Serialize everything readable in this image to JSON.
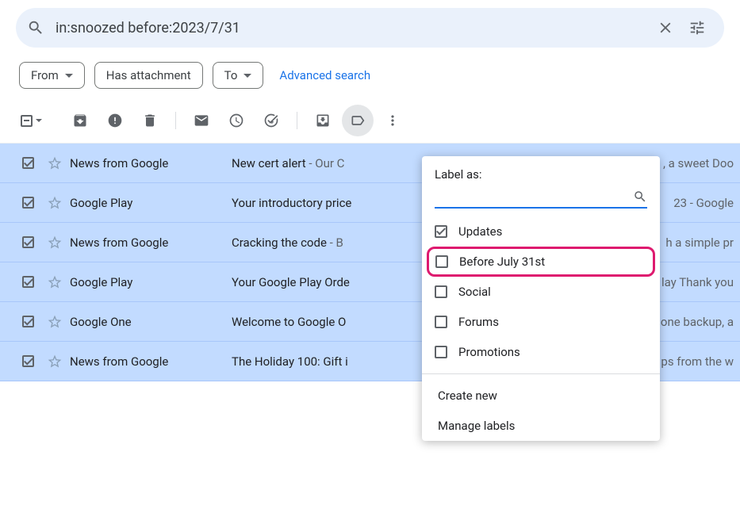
{
  "search": {
    "query": "in:snoozed before:2023/7/31"
  },
  "chips": {
    "from": "From",
    "has_attachment": "Has attachment",
    "to": "To",
    "advanced": "Advanced search"
  },
  "toolbar": {
    "more_tooltip": "More"
  },
  "emails": [
    {
      "sender": "News from Google",
      "subject": "New cert alert",
      "snippet": " - Our C",
      "tail": ", a sweet Doo"
    },
    {
      "sender": "Google Play",
      "subject": "Your introductory price",
      "snippet": "",
      "tail": "23 - Google "
    },
    {
      "sender": "News from Google",
      "subject": "Cracking the code",
      "snippet": " - B",
      "tail": "h a simple pr"
    },
    {
      "sender": "Google Play",
      "subject": "Your Google Play Orde",
      "snippet": "",
      "tail": "lay Thank you"
    },
    {
      "sender": "Google One",
      "subject": "Welcome to Google O",
      "snippet": "",
      "tail": "one backup, a"
    },
    {
      "sender": "News from Google",
      "subject": "The Holiday 100: Gift i",
      "snippet": "",
      "tail": "ps from the w"
    }
  ],
  "label_popup": {
    "title": "Label as:",
    "search_value": "",
    "options": [
      {
        "label": "Updates",
        "checked": true,
        "highlight": false
      },
      {
        "label": "Before July 31st",
        "checked": false,
        "highlight": true
      },
      {
        "label": "Social",
        "checked": false,
        "highlight": false
      },
      {
        "label": "Forums",
        "checked": false,
        "highlight": false
      },
      {
        "label": "Promotions",
        "checked": false,
        "highlight": false
      }
    ],
    "create": "Create new",
    "manage": "Manage labels"
  }
}
